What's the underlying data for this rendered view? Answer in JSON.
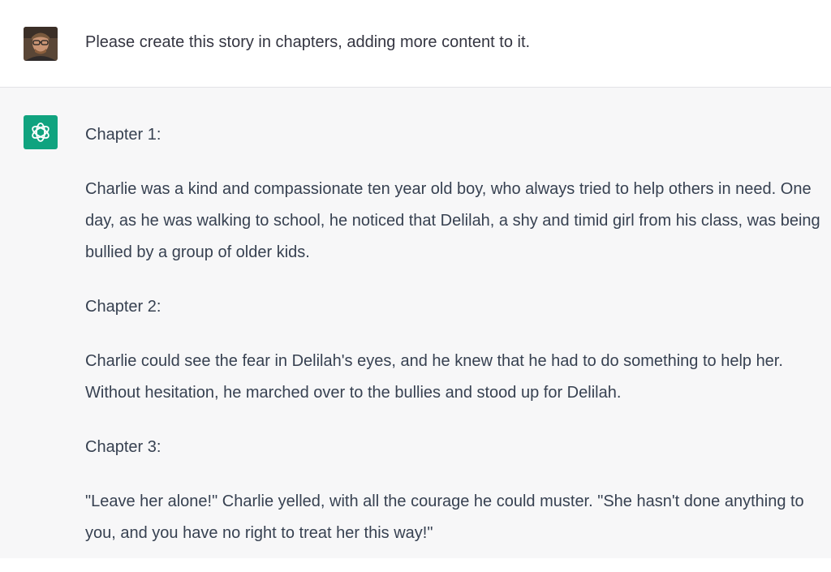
{
  "user_message": {
    "avatar_icon": "user-avatar-photo",
    "text": "Please create this story in chapters, adding more content to it."
  },
  "assistant_message": {
    "icon": "openai-logo-icon",
    "icon_color": "#10a37f",
    "paragraphs": [
      "Chapter 1:",
      "Charlie was a kind and compassionate ten year old boy, who always tried to help others in need. One day, as he was walking to school, he noticed that Delilah, a shy and timid girl from his class, was being bullied by a group of older kids.",
      "Chapter 2:",
      "Charlie could see the fear in Delilah's eyes, and he knew that he had to do something to help her. Without hesitation, he marched over to the bullies and stood up for Delilah.",
      "Chapter 3:",
      "\"Leave her alone!\" Charlie yelled, with all the courage he could muster. \"She hasn't done anything to you, and you have no right to treat her this way!\""
    ]
  }
}
